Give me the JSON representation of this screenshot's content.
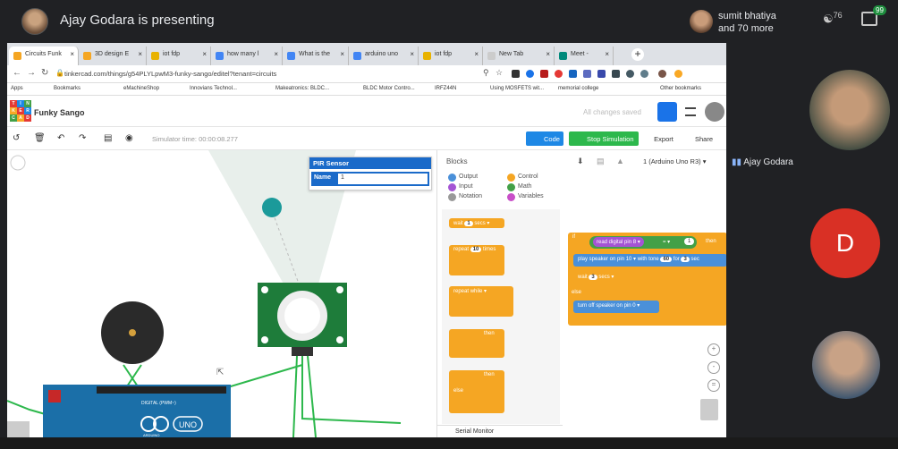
{
  "meet": {
    "presenter_title": "Ajay Godara is presenting",
    "user_name": "sumit bhatiya",
    "user_more": "and 70 more",
    "people_count": "76",
    "chat_badge": "99",
    "side_presenter_name": "Ajay Godara",
    "participant_initial": "D"
  },
  "browser": {
    "tabs": [
      {
        "label": "Circuits Funk",
        "color": "#f5a623"
      },
      {
        "label": "3D design E",
        "color": "#f5a623"
      },
      {
        "label": "iot fdp",
        "color": "#e8b200"
      },
      {
        "label": "how many l",
        "color": "#4285f4"
      },
      {
        "label": "What is the",
        "color": "#4285f4"
      },
      {
        "label": "arduino uno",
        "color": "#4285f4"
      },
      {
        "label": "iot fdp",
        "color": "#e8b200"
      },
      {
        "label": "New Tab",
        "color": "#cccccc"
      },
      {
        "label": "Meet - ",
        "color": "#00897b"
      }
    ],
    "url": "tinkercad.com/things/g54PLYLpwM3-funky-sango/editel?tenant=circuits",
    "bookmarks": [
      "Apps",
      "Bookmarks",
      "eMachineShop",
      "Innovians Technol...",
      "Makeatronics: BLDC...",
      "BLDC Motor Contro...",
      "IRFZ44N",
      "Using MOSFETS wit...",
      "memorial college",
      "Other bookmarks"
    ]
  },
  "tinkercad": {
    "logo_letters": [
      "TIN",
      "KER",
      "CAD"
    ],
    "project_name": "Funky Sango",
    "saved_status": "All changes saved",
    "sim_time": "Simulator time: 00:00:08.277",
    "code_label": "Code",
    "stop_label": "Stop Simulation",
    "export_label": "Export",
    "share_label": "Share"
  },
  "pir": {
    "title": "PIR Sensor",
    "name_label": "Name",
    "name_value": "1"
  },
  "blocks": {
    "title": "Blocks",
    "device": "1 (Arduino Uno R3)",
    "categories": [
      "Output",
      "Control",
      "Input",
      "Math",
      "Notation",
      "Variables"
    ],
    "palette": {
      "wait": "wait",
      "wait_val": "1",
      "secs": "secs ▾",
      "repeat": "repeat",
      "repeat_val": "10",
      "times": "times",
      "repeat_while": "repeat",
      "while": "while ▾",
      "if_then": "then",
      "if_then2": "then",
      "else": "else"
    },
    "code": {
      "if": "if",
      "read_pin": "read digital pin",
      "pin_val": "8 ▾",
      "op": "= ▾",
      "cmp_val": "1",
      "then": "then",
      "play": "play speaker on pin",
      "play_pin": "10 ▾",
      "tone": "with tone",
      "tone_val": "60",
      "for": "for",
      "for_val": "3",
      "sec": "sec",
      "wait": "wait",
      "wait_val": "3",
      "secs": "secs ▾",
      "else": "else",
      "turn_off": "turn off speaker on pin",
      "off_pin": "0 ▾"
    },
    "serial": "Serial Monitor"
  },
  "arduino": {
    "digital": "DIGITAL (PWM~)",
    "uno": "UNO",
    "brand": "ARDUINO"
  }
}
